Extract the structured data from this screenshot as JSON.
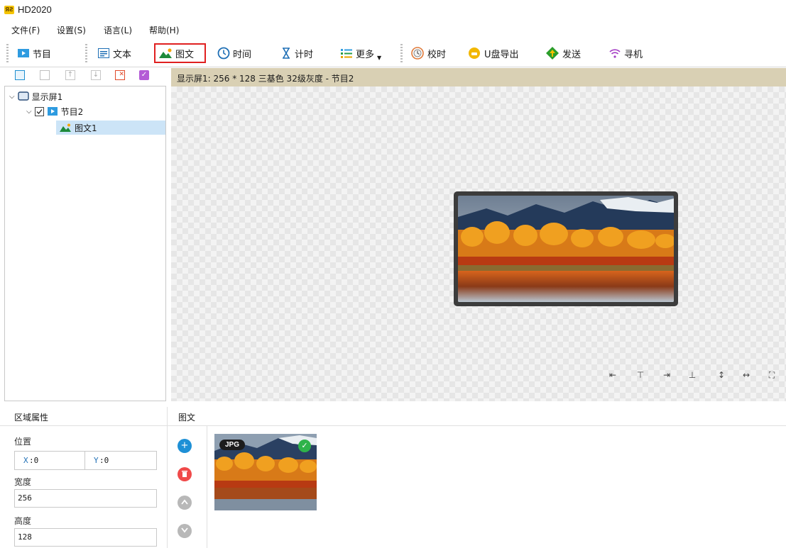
{
  "window": {
    "title": "HD2020",
    "logo_text": "ЯƧ"
  },
  "menu": [
    {
      "label": "文件(F)"
    },
    {
      "label": "设置(S)"
    },
    {
      "label": "语言(L)"
    },
    {
      "label": "帮助(H)"
    }
  ],
  "toolbar": {
    "program": "节目",
    "text": "文本",
    "graphic": "图文",
    "clock": "时间",
    "timer": "计时",
    "more": "更多",
    "sync_time": "校时",
    "usb_export": "U盘导出",
    "send": "发送",
    "search_device": "寻机",
    "highlighted_item": "graphic"
  },
  "tree": {
    "screen": "显示屏1",
    "program": "节目2",
    "graphic": "图文1"
  },
  "canvas": {
    "header": "显示屏1: 256 * 128 三基色 32级灰度 - 节目2"
  },
  "attr": {
    "title": "区域属性",
    "position_label": "位置",
    "x_label": "X",
    "x_value": ":0",
    "y_label": "Y",
    "y_value": ":0",
    "width_label": "宽度",
    "width_value": "256",
    "height_label": "高度",
    "height_value": "128"
  },
  "content": {
    "title": "图文",
    "thumb_badge": "JPG"
  },
  "colors": {
    "accent_blue": "#1e90d6",
    "highlight_red": "#e02020",
    "canvas_header": "#d9d0b4",
    "add_button": "#1e90d6",
    "delete_button": "#f04a4a",
    "disabled_button": "#b8b8b8",
    "selected_row": "#cce4f7"
  }
}
